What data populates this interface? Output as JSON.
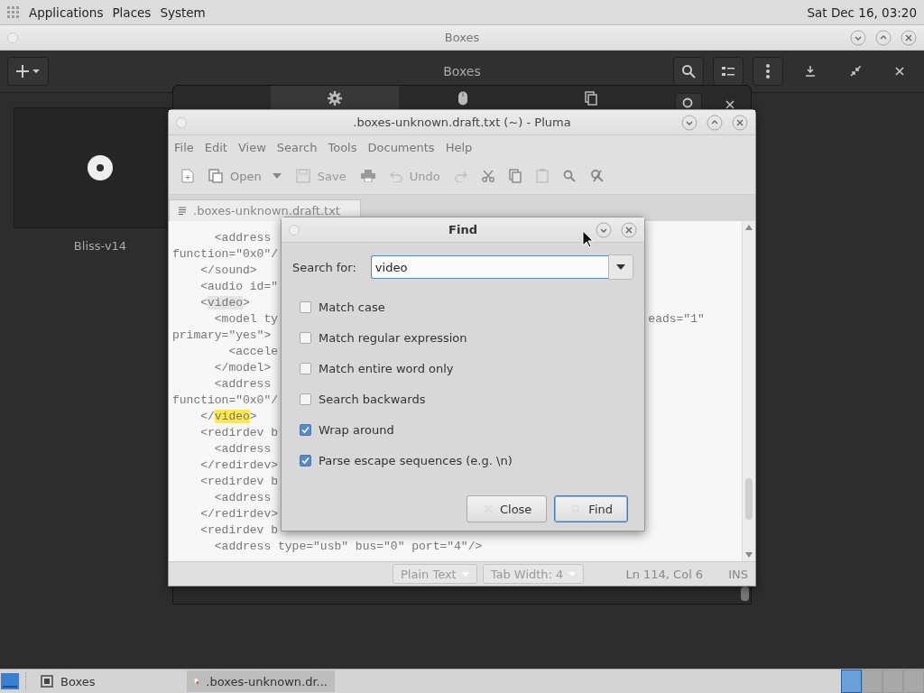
{
  "top_panel": {
    "menus": [
      "Applications",
      "Places",
      "System"
    ],
    "clock": "Sat Dec 16, 03:20"
  },
  "boxes_window": {
    "title": "Boxes",
    "header_title": "Boxes",
    "machines": [
      {
        "name": "Bliss-v14"
      }
    ],
    "properties_tabs": [
      {
        "kind": "settings",
        "selected": true
      },
      {
        "kind": "mouse",
        "selected": false
      },
      {
        "kind": "copy",
        "selected": false
      }
    ]
  },
  "pluma": {
    "title": ".boxes-unknown.draft.txt (~) - Pluma",
    "menu": [
      "File",
      "Edit",
      "View",
      "Search",
      "Tools",
      "Documents",
      "Help"
    ],
    "toolbar": [
      {
        "kind": "new",
        "disabled": false
      },
      {
        "kind": "open",
        "label": "Open",
        "disabled": false
      },
      {
        "kind": "save",
        "label": "Save",
        "disabled": true
      },
      {
        "kind": "print",
        "disabled": false
      },
      {
        "kind": "undo",
        "label": "Undo",
        "disabled": true
      },
      {
        "kind": "redo",
        "disabled": true
      },
      {
        "kind": "cut",
        "disabled": false
      },
      {
        "kind": "copy",
        "disabled": false
      },
      {
        "kind": "paste",
        "disabled": true
      },
      {
        "kind": "find",
        "disabled": false
      },
      {
        "kind": "replace",
        "disabled": false
      }
    ],
    "tabs": [
      {
        "label": ".boxes-unknown.draft.txt",
        "selected": true
      }
    ],
    "lines": [
      {
        "segments": [
          {
            "text": "      <address ",
            "selected": false,
            "matched": false
          }
        ]
      },
      {
        "segments": [
          {
            "text": "function=\"0x0\"/",
            "selected": false,
            "matched": false
          }
        ]
      },
      {
        "segments": [
          {
            "text": "    </sound>",
            "selected": false,
            "matched": false
          }
        ]
      },
      {
        "segments": [
          {
            "text": "    <audio id=\"",
            "selected": false,
            "matched": false
          }
        ]
      },
      {
        "segments": [
          {
            "text": "    <",
            "selected": false,
            "matched": false
          },
          {
            "text": "video",
            "selected": true,
            "matched": false
          },
          {
            "text": ">",
            "selected": false,
            "matched": false
          }
        ]
      },
      {
        "segments": [
          {
            "text": "      <model ty",
            "selected": false,
            "matched": false
          }
        ],
        "tail": "eads=\"1\""
      },
      {
        "segments": [
          {
            "text": "primary=\"yes\">",
            "selected": false,
            "matched": false
          }
        ]
      },
      {
        "segments": [
          {
            "text": "        <accele",
            "selected": false,
            "matched": false
          }
        ]
      },
      {
        "segments": [
          {
            "text": "      </model>",
            "selected": false,
            "matched": false
          }
        ]
      },
      {
        "segments": [
          {
            "text": "      <address ",
            "selected": false,
            "matched": false
          }
        ]
      },
      {
        "segments": [
          {
            "text": "function=\"0x0\"/",
            "selected": false,
            "matched": false
          }
        ]
      },
      {
        "segments": [
          {
            "text": "    </",
            "selected": false,
            "matched": false
          },
          {
            "text": "video",
            "selected": false,
            "matched": true
          },
          {
            "text": ">",
            "selected": false,
            "matched": false
          }
        ]
      },
      {
        "segments": [
          {
            "text": "    <redirdev b",
            "selected": false,
            "matched": false
          }
        ]
      },
      {
        "segments": [
          {
            "text": "      <address ",
            "selected": false,
            "matched": false
          }
        ]
      },
      {
        "segments": [
          {
            "text": "    </redirdev>",
            "selected": false,
            "matched": false
          }
        ]
      },
      {
        "segments": [
          {
            "text": "    <redirdev b",
            "selected": false,
            "matched": false
          }
        ]
      },
      {
        "segments": [
          {
            "text": "      <address ",
            "selected": false,
            "matched": false
          }
        ]
      },
      {
        "segments": [
          {
            "text": "    </redirdev>",
            "selected": false,
            "matched": false
          }
        ]
      },
      {
        "segments": [
          {
            "text": "    <redirdev b",
            "selected": false,
            "matched": false
          }
        ]
      },
      {
        "segments": [
          {
            "text": "      <address type=\"usb\" bus=\"0\" port=\"4\"/>",
            "selected": false,
            "matched": false
          }
        ]
      }
    ],
    "status": {
      "language": "Plain Text",
      "tab_width": "Tab Width: 4",
      "position": "Ln 114, Col 6",
      "mode": "INS"
    }
  },
  "find_dialog": {
    "title": "Find",
    "search_label": "Search for:",
    "search_value": "video",
    "options": [
      {
        "label": "Match case",
        "checked": false
      },
      {
        "label": "Match regular expression",
        "checked": false
      },
      {
        "label": "Match entire word only",
        "checked": false
      },
      {
        "label": "Search backwards",
        "checked": false
      },
      {
        "label": "Wrap around",
        "checked": true
      },
      {
        "label": "Parse escape sequences (e.g. \\n)",
        "checked": true
      }
    ],
    "buttons": [
      {
        "kind": "close",
        "label": "Close",
        "default": false
      },
      {
        "kind": "find",
        "label": "Find",
        "default": true
      }
    ]
  },
  "taskbar": {
    "tasks": [
      {
        "kind": "boxes",
        "label": "Boxes",
        "selected": false
      },
      {
        "kind": "editor",
        "label": ".boxes-unknown.dr...",
        "selected": true
      }
    ],
    "workspaces": [
      {
        "selected": true
      },
      {
        "selected": false
      },
      {
        "selected": false
      },
      {
        "selected": false
      }
    ]
  }
}
